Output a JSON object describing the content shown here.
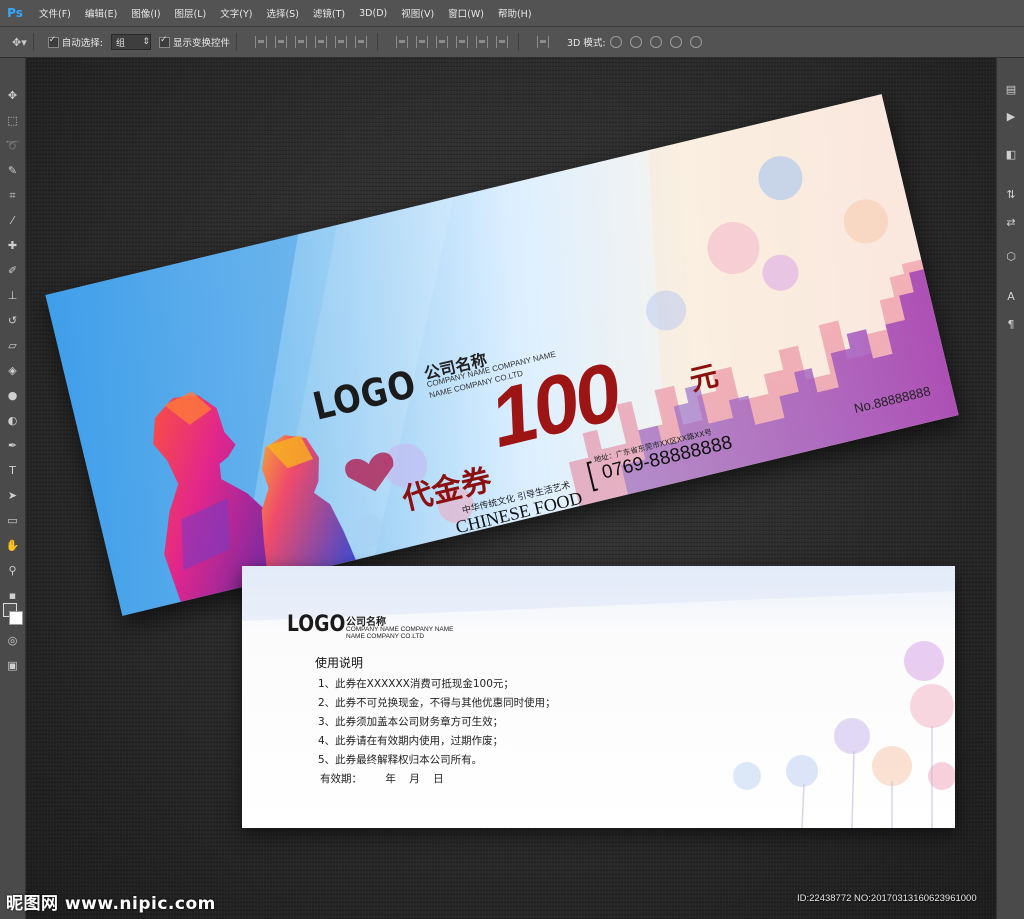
{
  "app": {
    "logo": "Ps",
    "menu": [
      "文件(F)",
      "编辑(E)",
      "图像(I)",
      "图层(L)",
      "文字(Y)",
      "选择(S)",
      "滤镜(T)",
      "3D(D)",
      "视图(V)",
      "窗口(W)",
      "帮助(H)"
    ]
  },
  "options_bar": {
    "auto_select_label": "自动选择:",
    "auto_select_value": "组",
    "show_transform_label": "显示变换控件",
    "mode_3d_label": "3D 模式:"
  },
  "voucher_front": {
    "logo": "LOGO",
    "company_cn": "公司名称",
    "company_en_line1": "COMPANY NAME COMPANY NAME",
    "company_en_line2": "NAME COMPANY CO.LTD",
    "amount": "100",
    "currency": "元",
    "title": "代金券",
    "slogan": "中华传统文化 引导生活艺术",
    "brand": "CHINESE FOOD",
    "address": "地址：广东省东莞市XX区XX路XX号",
    "phone": "0769-88888888",
    "serial_no": "No.88888888"
  },
  "voucher_back": {
    "logo": "LOGO",
    "company_cn": "公司名称",
    "company_en_line1": "COMPANY NAME COMPANY NAME",
    "company_en_line2": "NAME COMPANY CO.LTD",
    "instructions_title": "使用说明",
    "rules": [
      "1、此券在XXXXXX消费可抵现金100元；",
      "2、此券不可兑换现金，不得与其他优惠同时使用；",
      "3、此券须加盖本公司财务章方可生效；",
      "4、此券请在有效期内使用，过期作废；",
      "5、此券最终解释权归本公司所有。"
    ],
    "validity": "有效期：       年    月    日"
  },
  "watermark": {
    "site": "昵图网 www.nipic.com",
    "id_text": "ID:22438772 NO:20170313160623961000"
  },
  "colors": {
    "accent_red": "#9c1414",
    "ps_blue": "#31a8ff"
  }
}
